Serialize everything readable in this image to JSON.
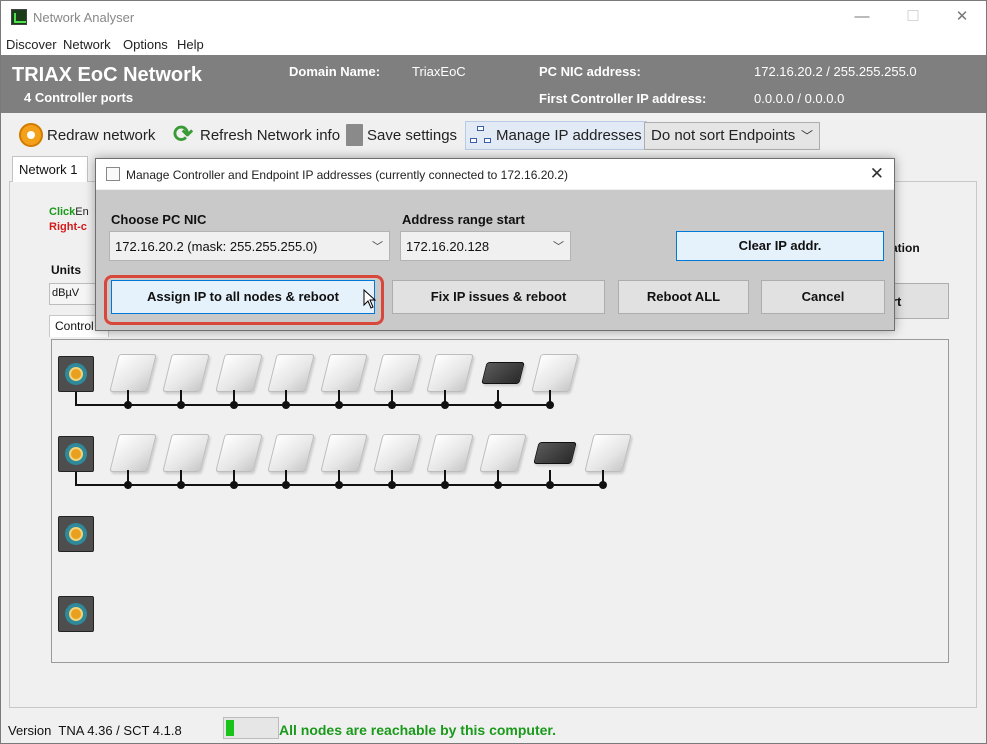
{
  "window": {
    "title": "Network Analyser",
    "controls": [
      "—",
      "☐",
      "✕"
    ]
  },
  "menu": [
    "Discover",
    "Network",
    "Options",
    "Help"
  ],
  "header": {
    "title": "TRIAX EoC Network",
    "subtitle": "4 Controller ports",
    "domain_label": "Domain Name:",
    "domain_value": "TriaxEoC",
    "pc_nic_label": "PC NIC address:",
    "pc_nic_value": "172.16.20.2 / 255.255.255.0",
    "first_ctrl_label": "First Controller IP address:",
    "first_ctrl_value": "0.0.0.0 / 0.0.0.0"
  },
  "toolbar": {
    "redraw": "Redraw network",
    "refresh": "Refresh Network info",
    "save": "Save settings",
    "manage_ip": "Manage IP addresses",
    "sort": "Do not sort Endpoints"
  },
  "tabs": {
    "network1": "Network 1"
  },
  "panel": {
    "hint_click": "Click",
    "hint_click_rest": "En",
    "hint_right": "Right-c",
    "units_label": "Units",
    "units_value": "dBµV",
    "controller_tab": "Control",
    "right_fragment": "ation",
    "right_button": "rt"
  },
  "dialog": {
    "title": "Manage Controller and Endpoint IP addresses (currently connected to 172.16.20.2)",
    "nic_label": "Choose PC NIC",
    "nic_value": "172.16.20.2 (mask: 255.255.255.0)",
    "range_label": "Address range start",
    "range_value": "172.16.20.128",
    "clear_btn": "Clear IP addr.",
    "assign_btn": "Assign IP to all nodes & reboot",
    "fix_btn": "Fix IP issues & reboot",
    "reboot_btn": "Reboot ALL",
    "cancel_btn": "Cancel"
  },
  "network": {
    "controllers": [
      {
        "endpoints": 9,
        "dark_index": 7
      },
      {
        "endpoints": 10,
        "dark_index": 8
      },
      {
        "endpoints": 0
      },
      {
        "endpoints": 0
      }
    ]
  },
  "status": {
    "version_label": "Version",
    "version_value": "TNA 4.36 / SCT 4.1.8",
    "progress": 0.15,
    "message": "All nodes are reachable by this computer.",
    "message_color": "#1a9a1a"
  }
}
